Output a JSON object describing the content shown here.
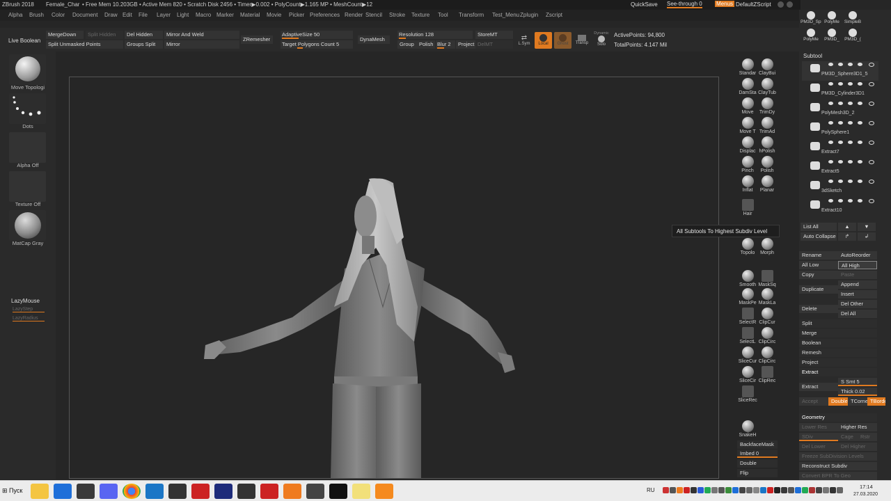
{
  "titlebar": {
    "app": "ZBrush 2018",
    "doc": "Female_Char",
    "stats": "• Free Mem 10.203GB • Active Mem 820 • Scratch Disk 2456 • Timer▶0.002 • PolyCount▶1.165 MP • MeshCount▶12",
    "quicksave": "QuickSave",
    "seethrough": "See-through  0",
    "menus": "Menus",
    "script": "DefaultZScript"
  },
  "menubar": {
    "items": [
      "Alpha",
      "Brush",
      "Color",
      "Document",
      "Draw",
      "Edit",
      "File",
      "Layer",
      "Light",
      "Macro",
      "Marker",
      "Material",
      "Movie",
      "Picker",
      "Preferences",
      "Render",
      "Stencil",
      "Stroke",
      "Texture",
      "Tool",
      "Transform",
      "Test_Menu",
      "Zplugin",
      "Zscript"
    ]
  },
  "toolbar": {
    "live_boolean": "Live Boolean",
    "merge_down": "MergeDown",
    "split_hidden": "Split Hidden",
    "del_hidden": "Del Hidden",
    "mirror_weld": "Mirror And Weld",
    "split_unmasked": "Split Unmasked Points",
    "groups_split": "Groups Split",
    "mirror": "Mirror",
    "zremesher": "ZRemesher",
    "adaptive_size": "AdaptiveSize 50",
    "target_poly": "Target Polygons Count 5",
    "dynamesh": "DynaMesh",
    "resolution": "Resolution 128",
    "group": "Group",
    "polish": "Polish",
    "blur": "Blur 2",
    "project": "Project",
    "storemt": "StoreMT",
    "delmt": "DelMT",
    "lsym": "L.Sym",
    "local": "Local",
    "ghost": "Ghost",
    "transp": "Transp",
    "dynamic": "Dynamic",
    "solo": "Solo",
    "active_points": "ActivePoints: 94,800",
    "total_points": "TotalPoints: 4.147 Mil"
  },
  "leftbar": {
    "brush": "Move Topologi",
    "stroke": "Dots",
    "alpha": "Alpha Off",
    "texture": "Texture Off",
    "material": "MatCap Gray",
    "lazymouse": "LazyMouse",
    "lazystep": "LazyStep",
    "lazyradius": "LazyRadius"
  },
  "brushes": [
    [
      "Standar",
      "ClayBui"
    ],
    [
      "DamSta",
      "ClayTub"
    ],
    [
      "Move",
      "TrimDy"
    ],
    [
      "Move T",
      "TrimAd"
    ],
    [
      "Displac",
      "hPolish"
    ],
    [
      "Pinch",
      "Polish"
    ],
    [
      "Inflat",
      "Planar"
    ]
  ],
  "brushes2": {
    "hair": "Hair",
    "topology": "Topolo",
    "morph": "Morph",
    "smooth": "Smooth",
    "masksq": "MaskSq",
    "maskpe": "MaskPe",
    "maskla": "MaskLa",
    "selectr": "SelectR",
    "clipcur": "ClipCur",
    "selectl": "SelectL",
    "clipcirc": "ClipCirc",
    "slicecur": "SliceCur",
    "clipcirc2": "ClipCirc",
    "slicecir": "SliceCir",
    "cliprec": "ClipRec",
    "slicerec": "SliceRec",
    "snakeh": "SnakeH",
    "backfacemask": "BackfaceMask",
    "imbed": "Imbed 0",
    "double": "Double",
    "flip": "Flip"
  },
  "tooltip": "All Subtools To Highest Subdiv Level",
  "rightpanel": {
    "top_tools": [
      "PM3D_Sphere3",
      "PolyMe",
      "SimpleB",
      "PolyMe",
      "PM3D_",
      "PM3D_("
    ],
    "subtool_title": "Subtool",
    "subtools": [
      "PM3D_Sphere3D1_5",
      "PM3D_Cylinder3D1",
      "PolyMesh3D_2",
      "PolySphere1",
      "Extract7",
      "Extract5",
      "3dSketch",
      "Extract10"
    ],
    "list_all": "List All",
    "auto_collapse": "Auto Collapse",
    "rename": "Rename",
    "autoreorder": "AutoReorder",
    "all_low": "All Low",
    "all_high": "All High",
    "copy": "Copy",
    "paste": "Paste",
    "duplicate": "Duplicate",
    "append": "Append",
    "insert": "Insert",
    "delete": "Delete",
    "del_other": "Del Other",
    "del_all": "Del All",
    "split": "Split",
    "merge": "Merge",
    "boolean": "Boolean",
    "remesh": "Remesh",
    "project": "Project",
    "extract_title": "Extract",
    "extract": "Extract",
    "s_smt": "S Smt 5",
    "thick": "Thick 0.02",
    "accept": "Accept",
    "double": "Double",
    "tcorne": "TCorne",
    "tborde": "TBorde",
    "geometry": "Geometry",
    "lower_res": "Lower Res",
    "higher_res": "Higher Res",
    "sdiv": "SDiv",
    "cage": "Cage",
    "rstr": "Rstr",
    "del_lower": "Del Lower",
    "del_higher": "Del Higher",
    "freeze": "Freeze SubDivision Levels",
    "reconstruct": "Reconstruct Subdiv",
    "convert": "Convert BPR To Geo"
  },
  "taskbar": {
    "start": "Пуск",
    "lang": "RU",
    "time": "17:14",
    "date": "27.03.2020",
    "app_icons": [
      "folder-icon",
      "edge-icon",
      "kali-icon",
      "discord-icon",
      "chrome-icon",
      "steam-icon",
      "obs-icon",
      "app-icon",
      "photoshop-icon",
      "zbrush-icon",
      "substance-icon",
      "blender-icon",
      "marvelous-icon",
      "mari-icon",
      "folder2-icon",
      "vlc-icon"
    ],
    "tray_icons": [
      "tray-1-icon",
      "tray-2-icon",
      "tray-3-icon",
      "tray-4-icon",
      "tray-5-icon",
      "tray-6-icon",
      "tray-7-icon",
      "tray-8-icon",
      "tray-9-icon",
      "tray-10-icon",
      "tray-11-icon",
      "tray-12-icon",
      "tray-13-icon",
      "tray-14-icon",
      "tray-15-icon",
      "tray-16-icon",
      "tray-17-icon",
      "tray-18-icon",
      "tray-19-icon",
      "tray-20-icon",
      "tray-21-icon",
      "tray-22-icon",
      "tray-23-icon",
      "tray-24-icon",
      "tray-25-icon",
      "tray-26-icon",
      "tray-27-icon",
      "tray-28-icon",
      "tray-29-icon",
      "tray-30-icon",
      "tray-31-icon",
      "tray-32-icon",
      "tray-33-icon"
    ],
    "colors": {
      "accent": "#e07a20",
      "bg": "#ececec"
    }
  }
}
